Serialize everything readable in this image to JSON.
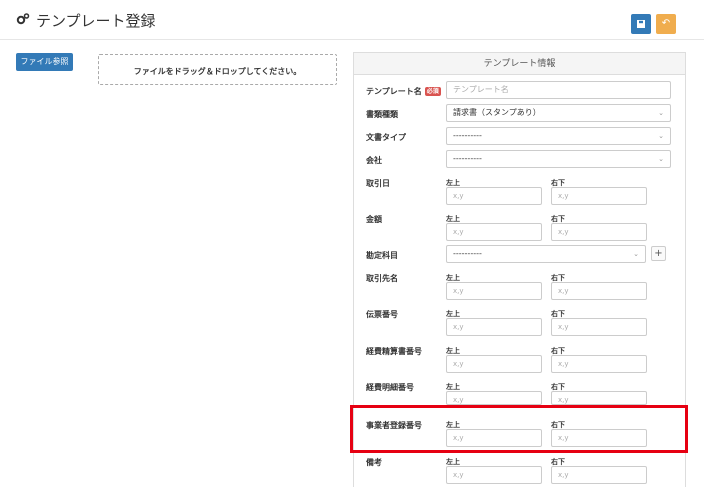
{
  "header": {
    "title": "テンプレート登録",
    "icon": "gear-icon",
    "save_icon": "floppy-icon",
    "back_icon": "undo-icon"
  },
  "upload": {
    "button_label": "ファイル参照",
    "dropzone_text": "ファイルをドラッグ＆ドロップしてください。"
  },
  "panel": {
    "title": "テンプレート情報"
  },
  "form": {
    "template_name": {
      "label": "テンプレート名",
      "required_badge": "必須",
      "placeholder": "テンプレート名"
    },
    "doc_kind": {
      "label": "書類種類",
      "value": "請求書（スタンプあり）"
    },
    "doc_type": {
      "label": "文書タイプ",
      "value": "----------"
    },
    "company": {
      "label": "会社",
      "value": "----------"
    },
    "account": {
      "label": "勘定科目",
      "value": "----------"
    },
    "coord_labels": {
      "top_left": "左上",
      "bottom_right": "右下",
      "placeholder": "x,y"
    },
    "coord_fields": [
      {
        "label": "取引日"
      },
      {
        "label": "金額"
      },
      {
        "label": "取引先名"
      },
      {
        "label": "伝票番号"
      },
      {
        "label": "経費精算書番号"
      },
      {
        "label": "経費明細番号"
      },
      {
        "label": "事業者登録番号"
      },
      {
        "label": "備考"
      }
    ]
  },
  "colors": {
    "primary": "#337ab7",
    "warning": "#f0ad4e",
    "highlight": "#e60012",
    "required": "#d9534f"
  }
}
